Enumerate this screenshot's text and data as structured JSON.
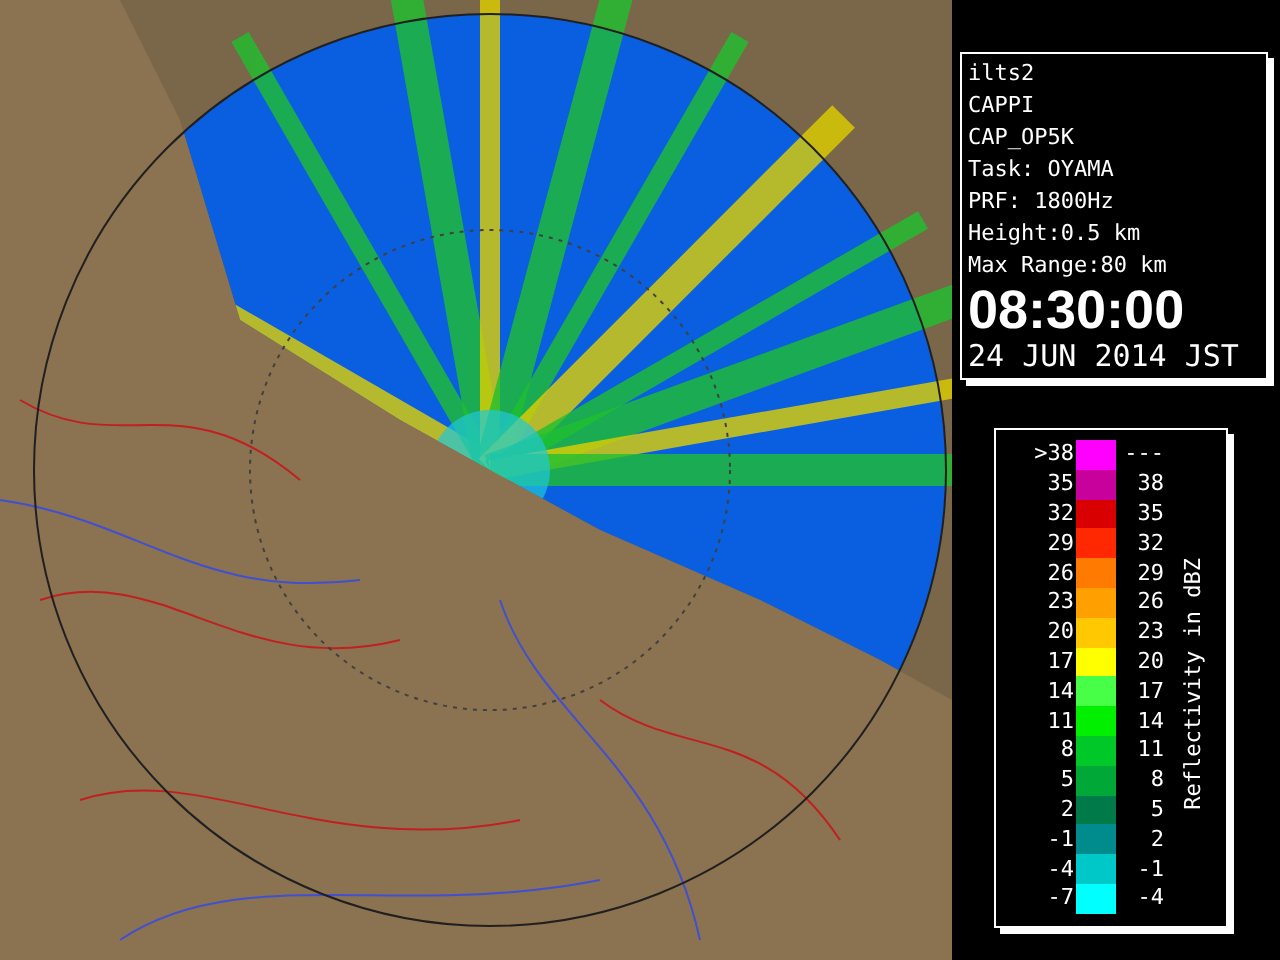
{
  "info_panel": {
    "lines": [
      "ilts2",
      "CAPPI",
      "CAP_OP5K",
      "Task: OYAMA",
      "PRF: 1800Hz",
      "Height:0.5 km",
      "Max Range:80 km"
    ],
    "time": "08:30:00",
    "date": "24 JUN 2014 JST"
  },
  "legend": {
    "title": "Reflectivity in dBZ",
    "rows": [
      {
        "low": ">38",
        "high": "---",
        "color": "#ff00ff"
      },
      {
        "low": "35",
        "high": "38",
        "color": "#c8009c"
      },
      {
        "low": "32",
        "high": "35",
        "color": "#d80000"
      },
      {
        "low": "29",
        "high": "32",
        "color": "#ff2800"
      },
      {
        "low": "26",
        "high": "29",
        "color": "#ff7a00"
      },
      {
        "low": "23",
        "high": "26",
        "color": "#ffa000"
      },
      {
        "low": "20",
        "high": "23",
        "color": "#ffc800"
      },
      {
        "low": "17",
        "high": "20",
        "color": "#ffff00"
      },
      {
        "low": "14",
        "high": "17",
        "color": "#48ff48"
      },
      {
        "low": "11",
        "high": "14",
        "color": "#00f000"
      },
      {
        "low": "8",
        "high": "11",
        "color": "#00c828"
      },
      {
        "low": "5",
        "high": "8",
        "color": "#00a838"
      },
      {
        "low": "2",
        "high": "5",
        "color": "#007a48"
      },
      {
        "low": "-1",
        "high": "2",
        "color": "#008c8c"
      },
      {
        "low": "-4",
        "high": "-1",
        "color": "#00c8c8"
      },
      {
        "low": "-7",
        "high": "-4",
        "color": "#00ffff"
      }
    ]
  }
}
